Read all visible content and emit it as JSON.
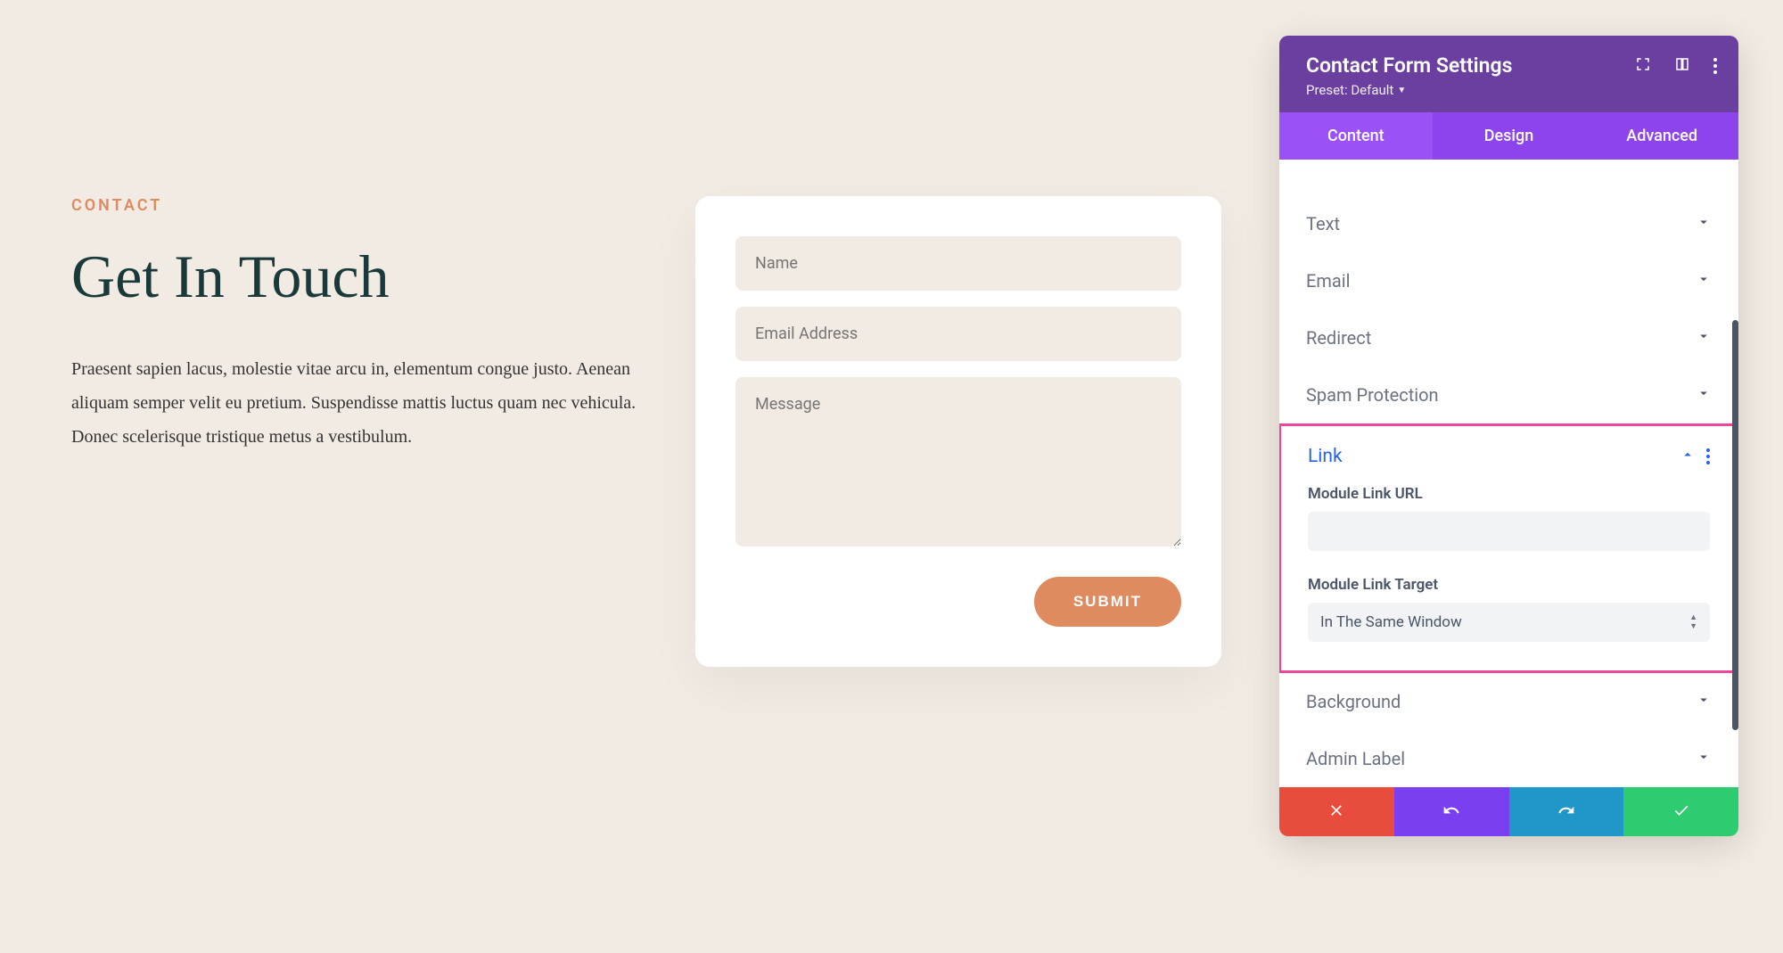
{
  "page": {
    "eyebrow": "CONTACT",
    "heading": "Get In Touch",
    "body": "Praesent sapien lacus, molestie vitae arcu in, elementum congue justo. Aenean aliquam semper velit eu pretium. Suspendisse mattis luctus quam nec vehicula. Donec scelerisque tristique metus a vestibulum."
  },
  "form": {
    "name_placeholder": "Name",
    "email_placeholder": "Email Address",
    "message_placeholder": "Message",
    "submit_label": "SUBMIT"
  },
  "panel": {
    "title": "Contact Form Settings",
    "preset_label": "Preset: Default",
    "tabs": {
      "content": "Content",
      "design": "Design",
      "advanced": "Advanced"
    },
    "sections": {
      "text": "Text",
      "email": "Email",
      "redirect": "Redirect",
      "spam": "Spam Protection",
      "link": "Link",
      "background": "Background",
      "admin": "Admin Label"
    },
    "link_fields": {
      "url_label": "Module Link URL",
      "url_value": "",
      "target_label": "Module Link Target",
      "target_value": "In The Same Window"
    }
  }
}
